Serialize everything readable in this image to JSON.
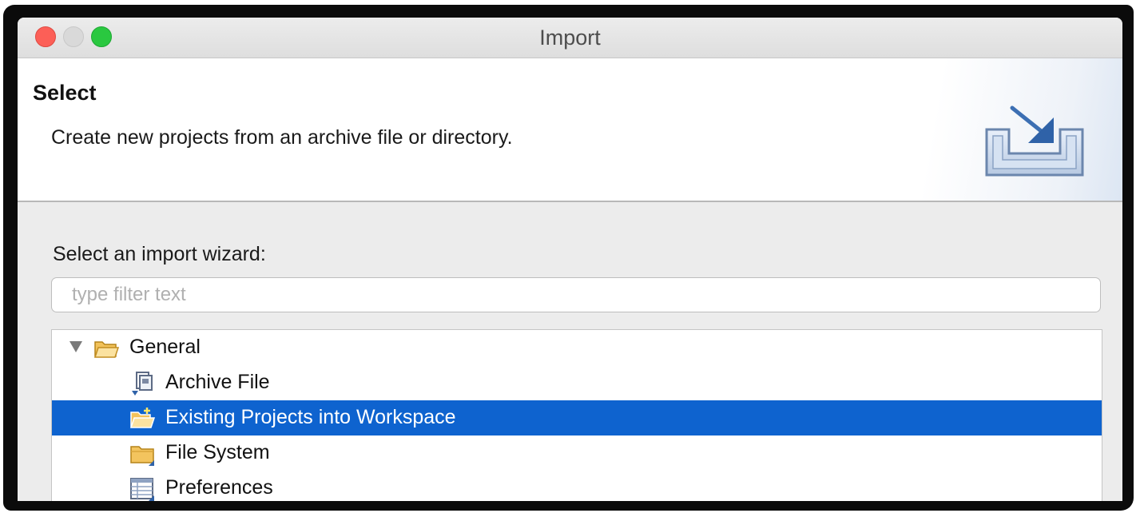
{
  "window": {
    "title": "Import"
  },
  "header": {
    "title": "Select",
    "description": "Create new projects from an archive file or directory."
  },
  "wizard": {
    "label": "Select an import wizard:",
    "filter_placeholder": "type filter text",
    "filter_value": ""
  },
  "tree": {
    "group": {
      "label": "General",
      "expanded": true,
      "icon": "folder-open-icon"
    },
    "items": [
      {
        "label": "Archive File",
        "icon": "archive-file-icon",
        "selected": false
      },
      {
        "label": "Existing Projects into Workspace",
        "icon": "project-folder-icon",
        "selected": true
      },
      {
        "label": "File System",
        "icon": "folder-icon",
        "selected": false
      },
      {
        "label": "Preferences",
        "icon": "preferences-icon",
        "selected": false
      }
    ]
  },
  "colors": {
    "selection": "#0e63cf",
    "close": "#fc5f57",
    "zoom": "#2ac840"
  }
}
